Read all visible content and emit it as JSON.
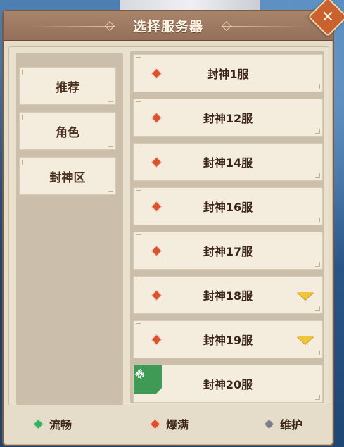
{
  "dialog": {
    "title": "选择服务器",
    "close_icon_glyph": "✕"
  },
  "tabs": [
    {
      "label": "推荐"
    },
    {
      "label": "角色"
    },
    {
      "label": "封神区"
    }
  ],
  "servers": [
    {
      "name": "封神1服",
      "status": "full",
      "expandable": false,
      "recommended": false
    },
    {
      "name": "封神12服",
      "status": "full",
      "expandable": false,
      "recommended": false
    },
    {
      "name": "封神14服",
      "status": "full",
      "expandable": false,
      "recommended": false
    },
    {
      "name": "封神16服",
      "status": "full",
      "expandable": false,
      "recommended": false
    },
    {
      "name": "封神17服",
      "status": "full",
      "expandable": false,
      "recommended": false
    },
    {
      "name": "封神18服",
      "status": "full",
      "expandable": true,
      "recommended": false
    },
    {
      "name": "封神19服",
      "status": "full",
      "expandable": true,
      "recommended": false
    },
    {
      "name": "封神20服",
      "status": "smooth",
      "expandable": false,
      "recommended": true,
      "ribbon_label": "荐"
    }
  ],
  "legend": [
    {
      "status": "smooth",
      "label": "流畅"
    },
    {
      "status": "full",
      "label": "爆满"
    },
    {
      "status": "maintenance",
      "label": "维护"
    }
  ],
  "colors": {
    "smooth": "#3fae5f",
    "full": "#d9532c",
    "maintenance": "#7d7a85",
    "expand_arrow": "#f0c53a",
    "title_bar": "#a8846b"
  }
}
